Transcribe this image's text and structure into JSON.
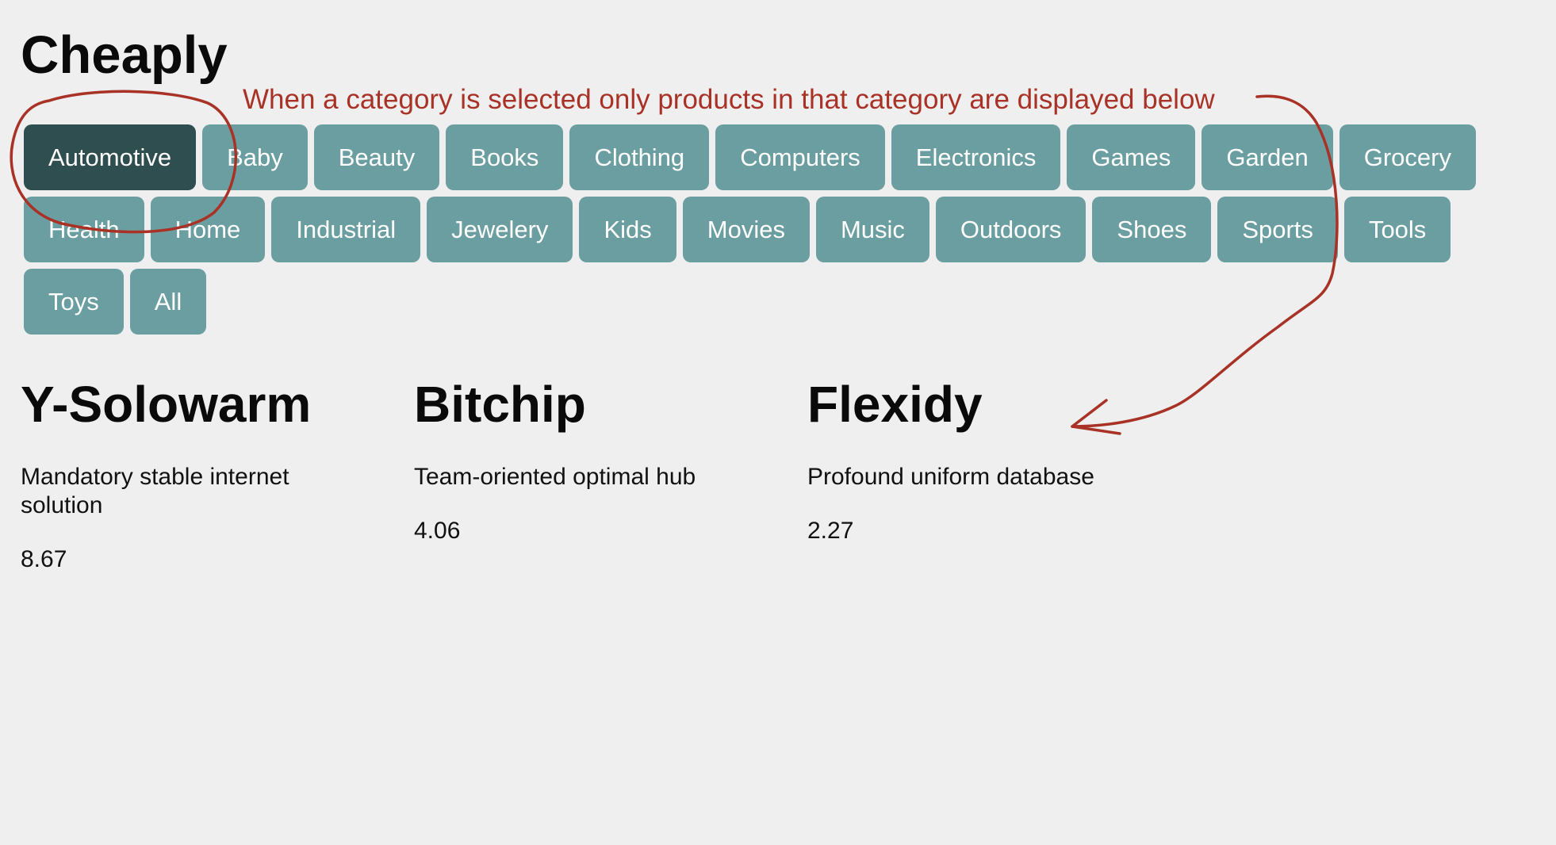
{
  "app": {
    "title": "Cheaply"
  },
  "categories": {
    "selected": "Automotive",
    "rows": [
      [
        "Automotive",
        "Baby",
        "Beauty",
        "Books",
        "Clothing",
        "Computers",
        "Electronics",
        "Games",
        "Garden",
        "Grocery"
      ],
      [
        "Health",
        "Home",
        "Industrial",
        "Jewelery",
        "Kids",
        "Movies",
        "Music",
        "Outdoors",
        "Shoes",
        "Sports",
        "Tools"
      ],
      [
        "Toys",
        "All"
      ]
    ]
  },
  "products": [
    {
      "name": "Y-Solowarm",
      "description": "Mandatory stable internet solution",
      "price": "8.67"
    },
    {
      "name": "Bitchip",
      "description": "Team-oriented optimal hub",
      "price": "4.06"
    },
    {
      "name": "Flexidy",
      "description": "Profound uniform database",
      "price": "2.27"
    }
  ],
  "annotation": {
    "text": "When a category is selected only products in that category are displayed below",
    "color": "#a83226"
  },
  "colors": {
    "background": "#efefef",
    "button": "#6b9ea0",
    "button_selected": "#2e4e4f",
    "button_text": "#ffffff"
  }
}
